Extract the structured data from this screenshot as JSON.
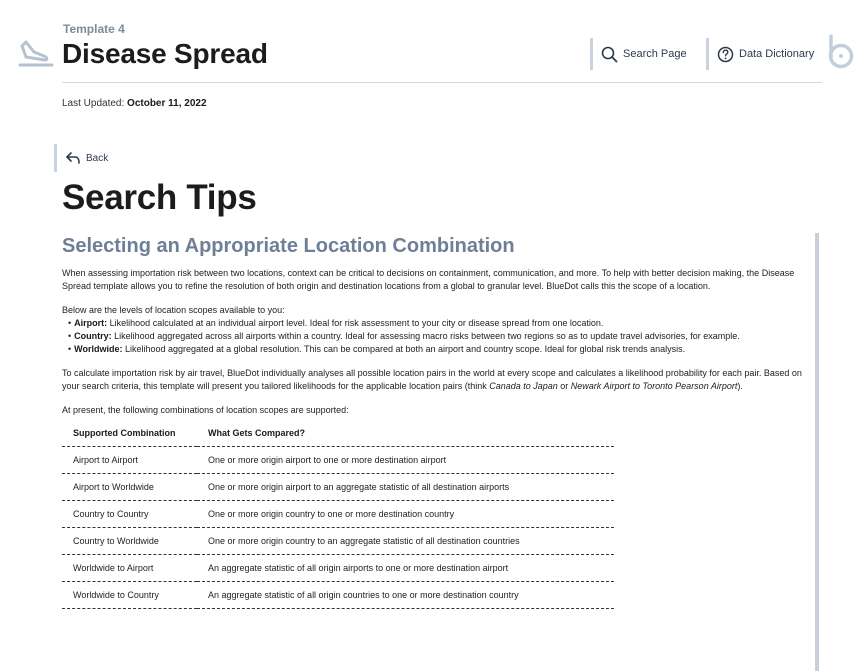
{
  "header": {
    "subtitle": "Template 4",
    "title": "Disease Spread",
    "nav": [
      {
        "label": "Search Page",
        "icon": "search-icon"
      },
      {
        "label": "Data Dictionary",
        "icon": "question-circle-icon"
      }
    ]
  },
  "meta": {
    "updated_label": "Last Updated:",
    "updated_date": "October 11, 2022"
  },
  "back_label": "Back",
  "page_title": "Search Tips",
  "section": {
    "title": "Selecting an Appropriate Location Combination",
    "intro": "When assessing importation risk between two locations, context can be critical to decisions on containment, communication, and more. To help with better decision making, the Disease Spread template allows you to refine the resolution of both origin and destination locations from a global to granular level. BlueDot calls this the scope of a location.",
    "levels_intro": "Below are the levels of location scopes available to you:",
    "levels": [
      {
        "name": "Airport:",
        "text": " Likelihood calculated at an individual airport level. Ideal for risk assessment to your city or disease spread from one location."
      },
      {
        "name": "Country:",
        "text": " Likelihood aggregated across all airports within a country. Ideal for assessing macro risks between two regions so as to update travel advisories, for example."
      },
      {
        "name": "Worldwide:",
        "text": " Likelihood aggregated at a global resolution. This can be compared at both an airport and country scope. Ideal for global risk trends analysis."
      }
    ],
    "calc_pre": "To calculate importation risk by air travel, BlueDot individually analyses all possible location pairs in the world at every scope and calculates a likelihood probability for each pair. Based on your search criteria, this template will present you tailored likelihoods for the applicable location pairs (think ",
    "calc_ex1": "Canada to Japan",
    "calc_mid": " or ",
    "calc_ex2": "Newark Airport to Toronto Pearson Airport",
    "calc_post": ").",
    "supported_intro": "At present, the following combinations of location scopes are supported:"
  },
  "table": {
    "headers": [
      "Supported Combination",
      "What Gets Compared?"
    ],
    "rows": [
      [
        "Airport to Airport",
        "One or more origin airport to one or more destination airport"
      ],
      [
        "Airport to Worldwide",
        "One or more origin airport to an aggregate statistic of all destination airports"
      ],
      [
        "Country to Country",
        "One or more origin country to one or more destination country"
      ],
      [
        "Country to Worldwide",
        "One or more origin country to an aggregate statistic of all destination countries"
      ],
      [
        "Worldwide to Airport",
        "An aggregate statistic of all origin airports to one or more destination airport"
      ],
      [
        "Worldwide to Country",
        "An aggregate statistic of all origin countries to one or more destination country"
      ]
    ]
  },
  "colors": {
    "section_title": "#6e7f96",
    "accent_bar": "#c9d2df",
    "nav_text": "#2b3a4e"
  },
  "icons": [
    "airplane-landing-icon",
    "search-icon",
    "question-circle-icon",
    "bluedot-logo-icon",
    "back-arrow-icon"
  ]
}
